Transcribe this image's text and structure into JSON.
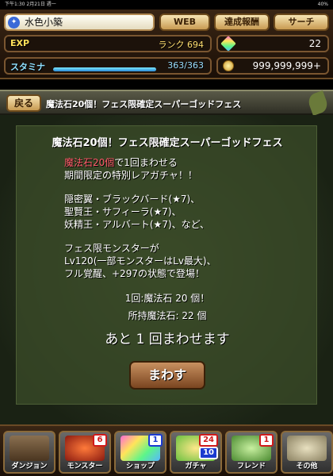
{
  "status_bar": {
    "time": "下午1:30",
    "date": "2月21日 週一",
    "battery": "40%"
  },
  "header": {
    "player_name": "水色小築",
    "web_button": "WEB",
    "achievements_button": "達成報酬",
    "search_button": "サーチ",
    "exp_label": "EXP",
    "rank_text": "ランク 694",
    "stamina_label": "スタミナ",
    "stamina_text": "363/363",
    "stamina_fill": 1.0,
    "magic_stones": "22",
    "coins": "999,999,999+"
  },
  "titlebar": {
    "back_label": "戻る",
    "title": "魔法石20個！フェス限確定スーパーゴッドフェス"
  },
  "panel": {
    "title": "魔法石20個！フェス限確定スーパーゴッドフェス",
    "line1_red": "魔法石20個",
    "line1_rest": "で1回まわせる",
    "line2": "期間限定の特別レアガチャ！！",
    "line3": "隠密翼・ブラックバード(★7)、",
    "line4": "聖賢王・サフィーラ(★7)、",
    "line5": "妖精王・アルバート(★7)、など、",
    "line6": "フェス限モンスターが",
    "line7": "Lv120(一部モンスターはLv最大)、",
    "line8": "フル覚醒、+297の状態で登場！",
    "cost_line": "1回:魔法石 20 個！",
    "owned_line": "所持魔法石: 22 個",
    "remaining_line": "あと 1 回まわせます",
    "spin_button": "まわす"
  },
  "nav": {
    "items": [
      {
        "label": "ダンジョン",
        "badge": "",
        "badge2": ""
      },
      {
        "label": "モンスター",
        "badge": "6",
        "badge2": ""
      },
      {
        "label": "ショップ",
        "badge": "1",
        "badge2": ""
      },
      {
        "label": "ガチャ",
        "badge": "24",
        "badge2": "10"
      },
      {
        "label": "フレンド",
        "badge": "1",
        "badge2": ""
      },
      {
        "label": "その他",
        "badge": "",
        "badge2": ""
      }
    ]
  }
}
